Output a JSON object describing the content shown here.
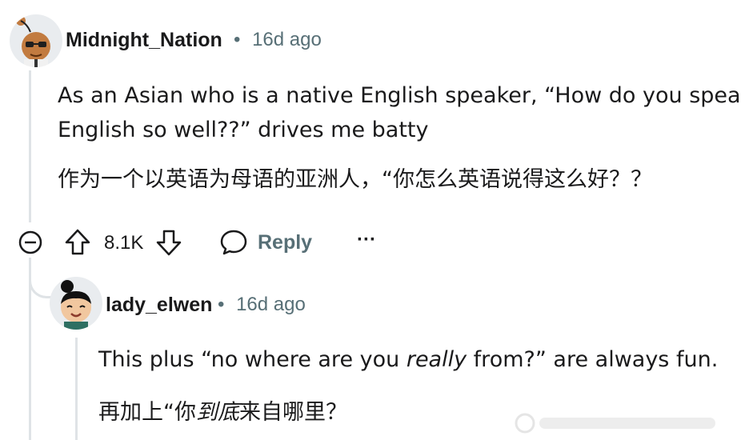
{
  "comment": {
    "username": "Midnight_Nation",
    "separator": "•",
    "timestamp": "16d ago",
    "body_line1": "As an Asian who is a native English speaker, “How do you speak",
    "body_line2": "English so well??” drives me batty",
    "translation": "作为一个以英语为母语的亚洲人，“你怎么英语说得这么好？？",
    "vote_count": "8.1K",
    "reply_label": "Reply",
    "more_label": "···",
    "icons": {
      "collapse": "collapse-minus-icon",
      "upvote": "upvote-arrow-icon",
      "downvote": "downvote-arrow-icon",
      "reply": "chat-bubble-icon",
      "more": "more-options-icon"
    }
  },
  "reply": {
    "username": "lady_elwen",
    "separator": "•",
    "timestamp": "16d ago",
    "body_prefix": "This plus “no where are you ",
    "body_italic": "really",
    "body_suffix": " from?” are always fun.",
    "translation_prefix": "再加上“你",
    "translation_italic": "到底",
    "translation_suffix": "来自哪里？"
  },
  "colors": {
    "text": "#1a1a1b",
    "meta": "#576f76",
    "thread_line": "#dfe3e6",
    "avatar_bg": "#e9ecef"
  }
}
